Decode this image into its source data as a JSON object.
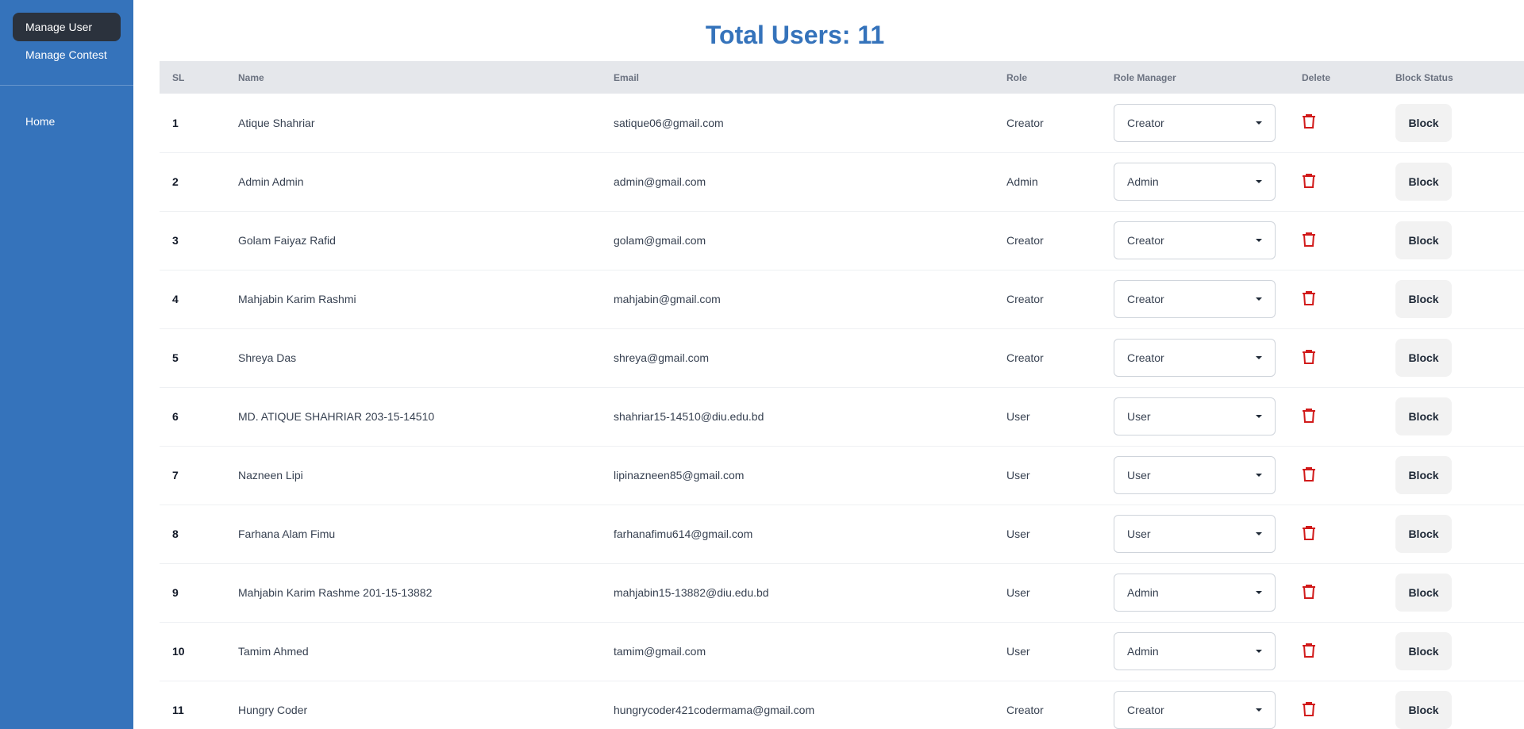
{
  "sidebar": {
    "items": [
      {
        "label": "Manage User"
      },
      {
        "label": "Manage Contest"
      },
      {
        "label": "Home"
      }
    ]
  },
  "title": "Total Users: 11",
  "table": {
    "headers": [
      "SL",
      "Name",
      "Email",
      "Role",
      "Role Manager",
      "Delete",
      "Block Status"
    ],
    "rows": [
      {
        "sl": "1",
        "name": "Atique Shahriar",
        "email": "satique06@gmail.com",
        "role": "Creator",
        "manager": "Creator",
        "block": "Block"
      },
      {
        "sl": "2",
        "name": "Admin Admin",
        "email": "admin@gmail.com",
        "role": "Admin",
        "manager": "Admin",
        "block": "Block"
      },
      {
        "sl": "3",
        "name": "Golam Faiyaz Rafid",
        "email": "golam@gmail.com",
        "role": "Creator",
        "manager": "Creator",
        "block": "Block"
      },
      {
        "sl": "4",
        "name": "Mahjabin Karim Rashmi",
        "email": "mahjabin@gmail.com",
        "role": "Creator",
        "manager": "Creator",
        "block": "Block"
      },
      {
        "sl": "5",
        "name": "Shreya Das",
        "email": "shreya@gmail.com",
        "role": "Creator",
        "manager": "Creator",
        "block": "Block"
      },
      {
        "sl": "6",
        "name": "MD. ATIQUE SHAHRIAR 203-15-14510",
        "email": "shahriar15-14510@diu.edu.bd",
        "role": "User",
        "manager": "User",
        "block": "Block"
      },
      {
        "sl": "7",
        "name": "Nazneen Lipi",
        "email": "lipinazneen85@gmail.com",
        "role": "User",
        "manager": "User",
        "block": "Block"
      },
      {
        "sl": "8",
        "name": "Farhana Alam Fimu",
        "email": "farhanafimu614@gmail.com",
        "role": "User",
        "manager": "User",
        "block": "Block"
      },
      {
        "sl": "9",
        "name": "Mahjabin Karim Rashme 201-15-13882",
        "email": "mahjabin15-13882@diu.edu.bd",
        "role": "User",
        "manager": "Admin",
        "block": "Block"
      },
      {
        "sl": "10",
        "name": "Tamim Ahmed",
        "email": "tamim@gmail.com",
        "role": "User",
        "manager": "Admin",
        "block": "Block"
      },
      {
        "sl": "11",
        "name": "Hungry Coder",
        "email": "hungrycoder421codermama@gmail.com",
        "role": "Creator",
        "manager": "Creator",
        "block": "Block"
      }
    ]
  },
  "colors": {
    "sidebar_bg": "#3573bb",
    "active_item_bg": "#2b323d",
    "title": "#3573bb",
    "header_bg": "#e5e7eb",
    "delete_icon": "#d11a1a",
    "block_button_bg": "#f2f2f2"
  },
  "icons": {
    "delete": "trash-icon",
    "dropdown": "chevron-down-icon"
  }
}
